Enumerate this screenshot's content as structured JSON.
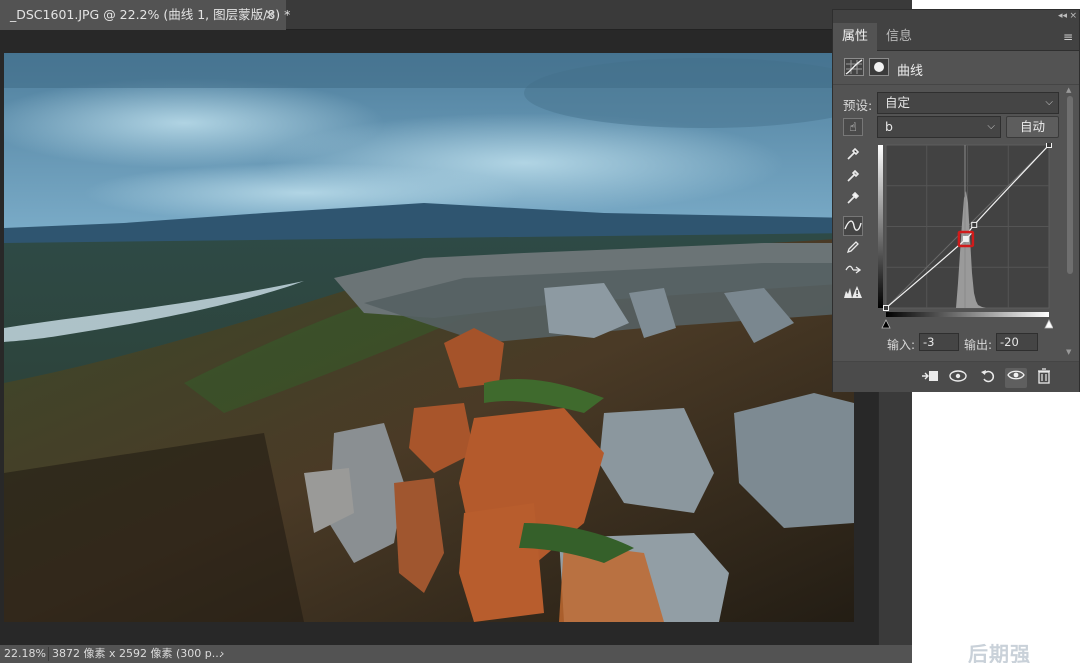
{
  "document": {
    "tab_title": "_DSC1601.JPG @ 22.2% (曲线 1, 图层蒙版/8) *",
    "close_symbol": "×",
    "photo_description_alt": ""
  },
  "status_bar": {
    "zoom": "22.18%",
    "dimensions": "3872 像素 x 2592 像素 (300 p...",
    "arrow": "›"
  },
  "panel": {
    "collapse": "◂◂",
    "close": "×",
    "tabs": [
      {
        "label": "属性"
      },
      {
        "label": "信息"
      }
    ],
    "menu_icon": "≡",
    "adjustment_title": "曲线",
    "preset_label": "预设:",
    "preset_value": "自定",
    "channel_value": "b",
    "auto_button": "自动",
    "input_label": "输入:",
    "input_value": "-3",
    "output_label": "输出:",
    "output_value": "-20"
  },
  "curve": {
    "channel": "b",
    "points": [
      {
        "input": -128,
        "output": -128
      },
      {
        "input": -3,
        "output": -20
      },
      {
        "input": 10,
        "output": 2
      },
      {
        "input": 127,
        "output": 127
      }
    ],
    "selected_point_input": -3,
    "selected_point_output": -20,
    "highlight_color": "#d11b1b"
  },
  "watermark": "后期强",
  "colors": {
    "app_bg": "#282828",
    "panel_bg": "#535353",
    "accent_red": "#d11b1b"
  }
}
